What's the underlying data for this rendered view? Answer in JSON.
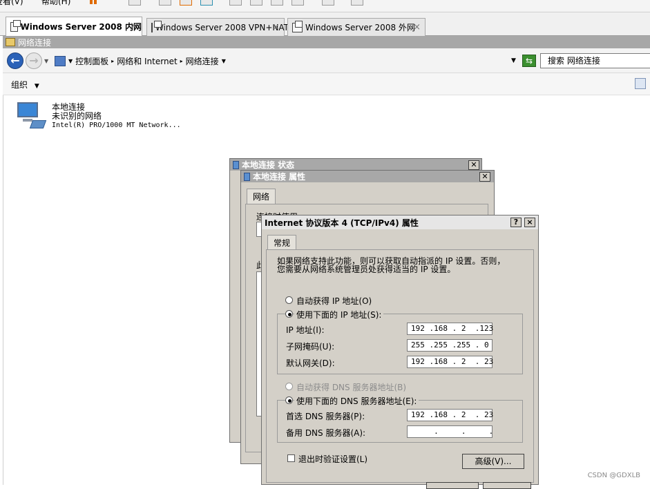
{
  "menu": {
    "item1": "查看(V)",
    "item2": "帮助(H)"
  },
  "tabs": [
    {
      "label": "Windows Server 2008 内网",
      "active": true
    },
    {
      "label": "Windows Server 2008 VPN+NAT",
      "active": false
    },
    {
      "label": "Windows Server 2008 外网",
      "active": false
    }
  ],
  "window": {
    "title": "网络连接"
  },
  "address": {
    "seg1": "控制面板",
    "seg2": "网络和 Internet",
    "seg3": "网络连接",
    "search_placeholder": "搜索 网络连接"
  },
  "toolbar": {
    "organize": "组织"
  },
  "connection": {
    "name": "本地连接",
    "status": "未识别的网络",
    "adapter": "Intel(R) PRO/1000 MT Network..."
  },
  "status_dialog": {
    "title": "本地连接 状态"
  },
  "props_dialog": {
    "title": "本地连接 属性",
    "tab": "网络",
    "connect_using": "连接时使用:",
    "partial_label": "此"
  },
  "ipv4": {
    "title": "Internet 协议版本 4 (TCP/IPv4) 属性",
    "help": "?",
    "close": "×",
    "tab": "常规",
    "description_line1": "如果网络支持此功能，则可以获取自动指派的 IP 设置。否则，",
    "description_line2": "您需要从网络系统管理员处获得适当的 IP 设置。",
    "auto_ip": "自动获得 IP 地址(O)",
    "manual_ip": "使用下面的 IP 地址(S):",
    "ip_label": "IP 地址(I):",
    "ip_value": "192 .168 . 2  .123",
    "mask_label": "子网掩码(U):",
    "mask_value": "255 .255 .255 . 0",
    "gateway_label": "默认网关(D):",
    "gateway_value": "192 .168 . 2  . 23",
    "auto_dns": "自动获得 DNS 服务器地址(B)",
    "manual_dns": "使用下面的 DNS 服务器地址(E):",
    "dns1_label": "首选 DNS 服务器(P):",
    "dns1_value": "192 .168 . 2  . 23",
    "dns2_label": "备用 DNS 服务器(A):",
    "dns2_value": "     .     .     .",
    "validate": "退出时验证设置(L)",
    "advanced": "高级(V)..."
  },
  "watermark": "CSDN @GDXLB"
}
